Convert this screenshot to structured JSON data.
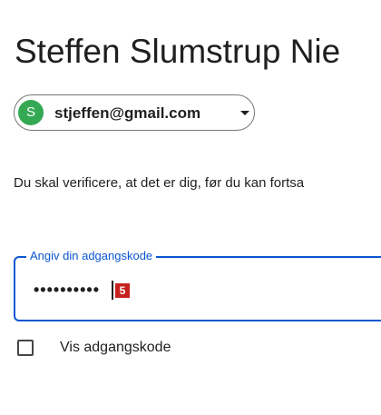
{
  "header": {
    "title": "Steffen Slumstrup Nie"
  },
  "account": {
    "avatar_letter": "S",
    "email": "stjeffen@gmail.com",
    "avatar_color": "#34a853"
  },
  "main": {
    "description": "Du skal verificere, at det er dig, før du kan fortsa"
  },
  "password_field": {
    "label": "Angiv din adgangskode",
    "value": "••••••••••",
    "marker": "5",
    "accent_color": "#0b57d0",
    "marker_color": "#c5221f"
  },
  "show_password": {
    "label": "Vis adgangskode",
    "checked": false
  }
}
